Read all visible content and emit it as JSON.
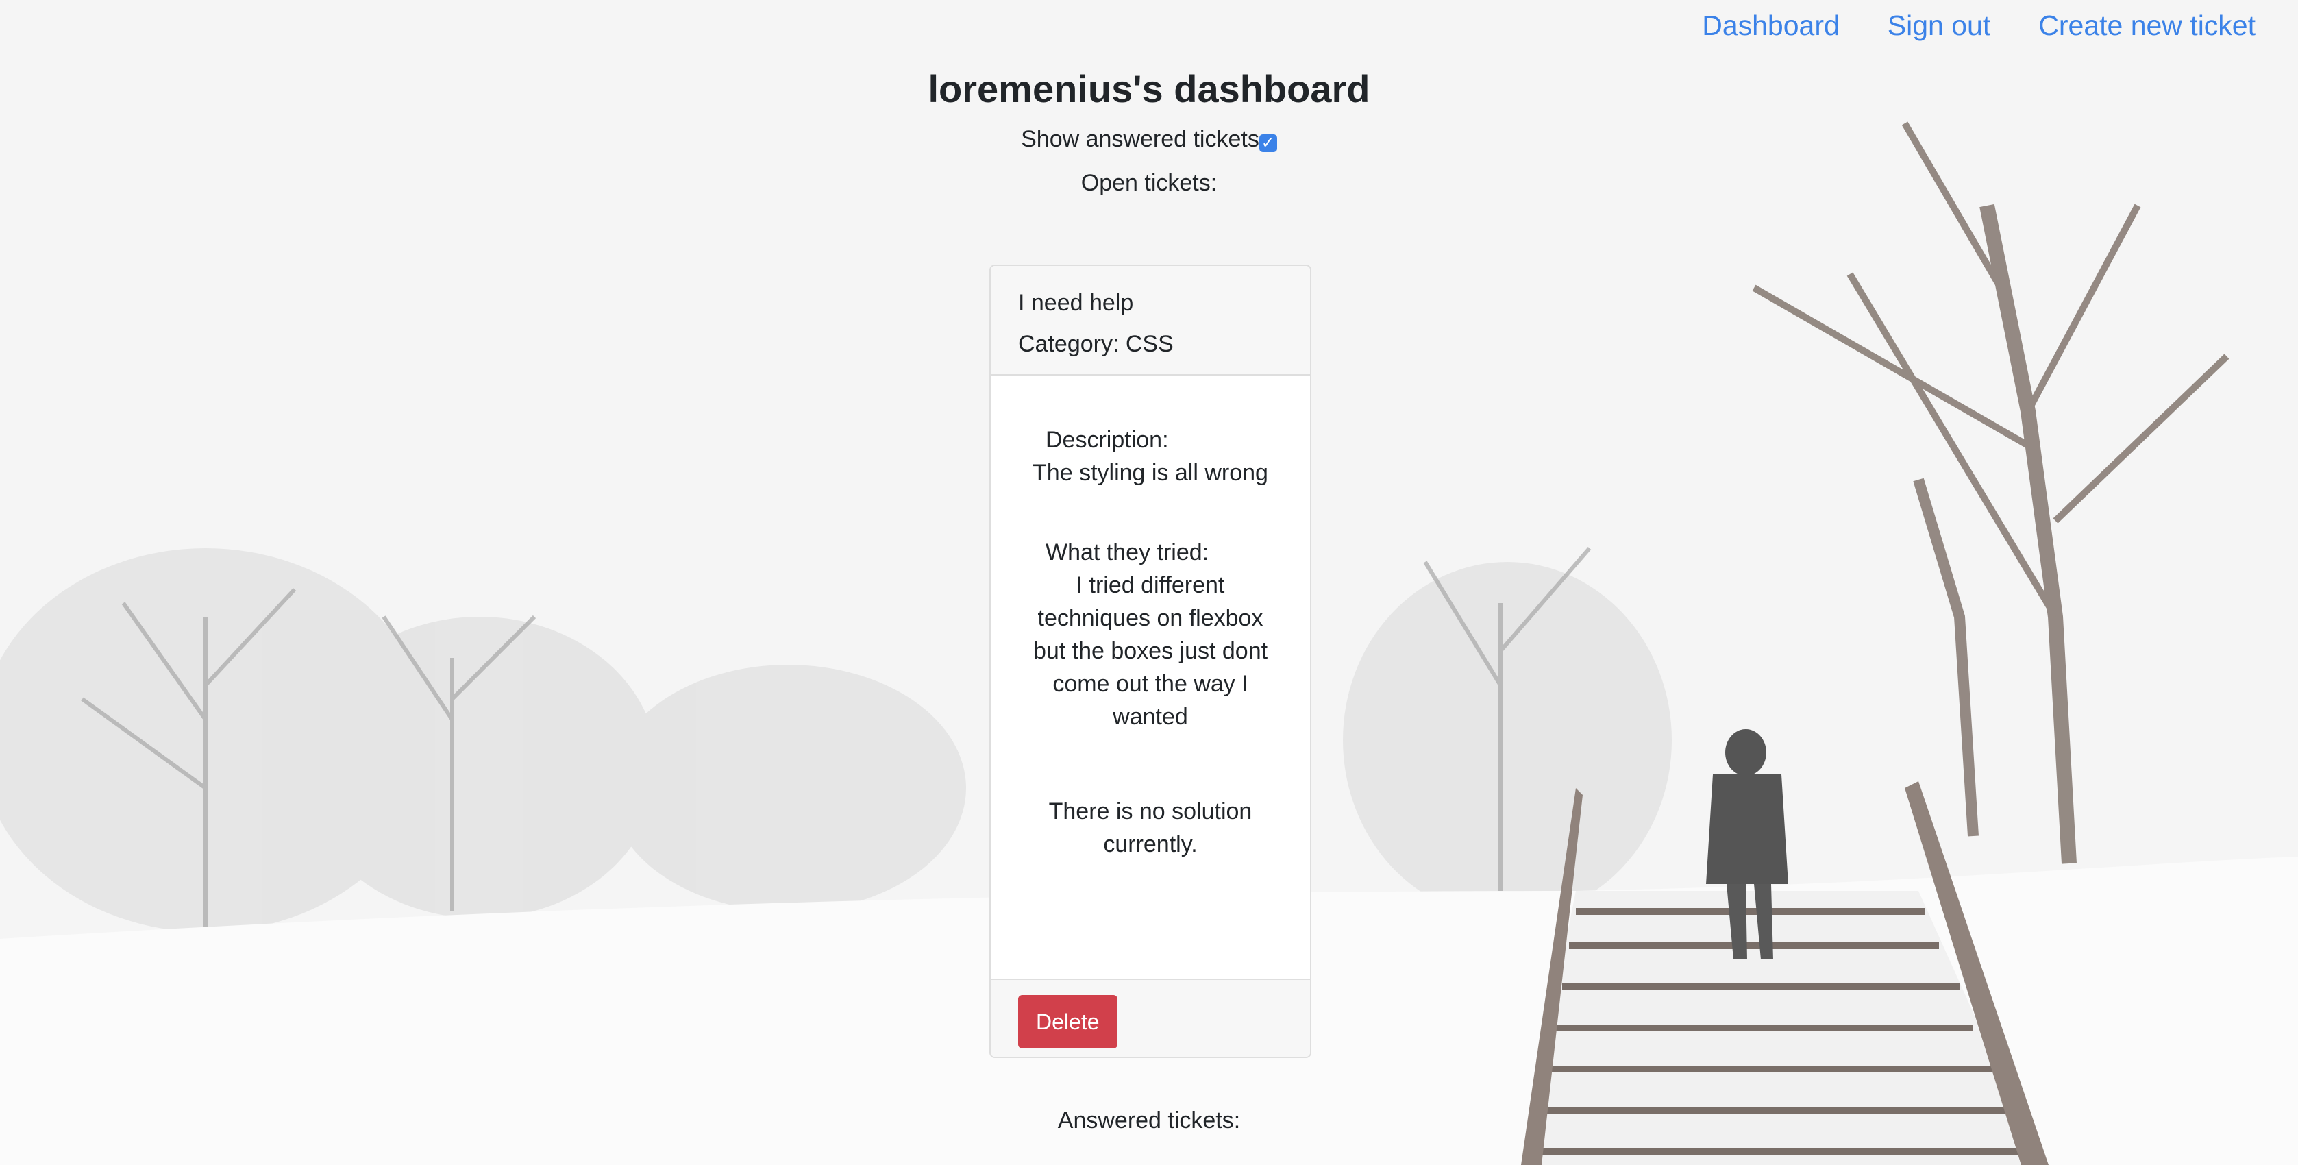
{
  "nav": {
    "dashboard": "Dashboard",
    "sign_out": "Sign out",
    "create_ticket": "Create new ticket"
  },
  "page": {
    "title": "loremenius's dashboard",
    "toggle_label": "Show answered tickets",
    "toggle_checked": true,
    "open_heading": "Open tickets:",
    "answered_heading": "Answered tickets:"
  },
  "ticket": {
    "title": "I need help",
    "category": "Category: CSS",
    "description_label": "Description:",
    "description": "The styling is all wrong",
    "tried_label": "What they tried:",
    "tried": "I tried different techniques on flexbox but the boxes just dont come out the way I wanted",
    "solution": "There is no solution currently.",
    "delete_label": "Delete"
  },
  "colors": {
    "link": "#3b82e8",
    "danger": "#d1404b",
    "checkbox": "#3b82e8"
  },
  "icons": {
    "checkbox": "check-icon"
  }
}
